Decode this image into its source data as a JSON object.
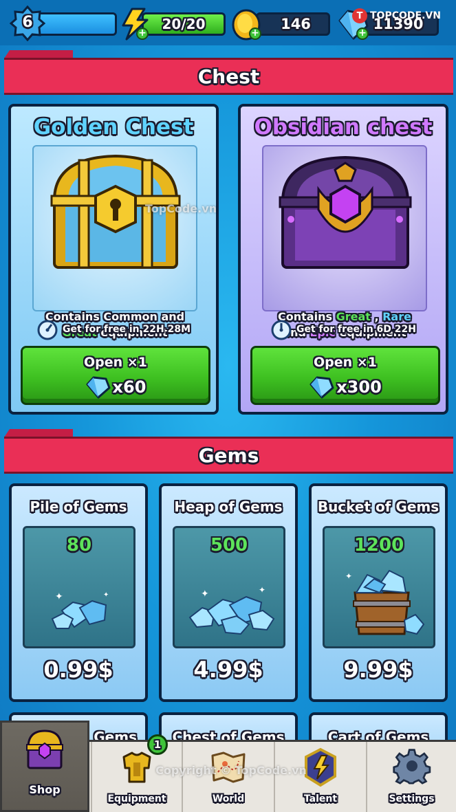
{
  "hud": {
    "level": "6",
    "level_progress": 1.0,
    "energy_text": "20/20",
    "energy_fraction": 1.0,
    "coins": "146",
    "gems": "11390",
    "watermark_logo": "TOPCODE.VN",
    "watermark_badge": "T"
  },
  "chest_section": {
    "title": "Chest",
    "cards": [
      {
        "name": "Golden Chest",
        "desc_pre": "Contains ",
        "desc_mid1": "Common",
        "desc_join": " and ",
        "desc_mid2": "Great",
        "desc_post": " equipment",
        "timer": "Get for free in 22H 28M",
        "open_label": "Open ×1",
        "price": "x60"
      },
      {
        "name": "Obsidian chest",
        "desc_pre": "Contains ",
        "desc_mid1": "Great",
        "desc_sep": " , ",
        "desc_mid2": "Rare",
        "desc_join": "and ",
        "desc_mid3": "Epic",
        "desc_post": " equipment",
        "timer": "Get for free in 6D 22H",
        "open_label": "Open ×1",
        "price": "x300"
      }
    ]
  },
  "gems_section": {
    "title": "Gems",
    "cards": [
      {
        "title": "Pile of Gems",
        "amount": "80",
        "price": "0.99$"
      },
      {
        "title": "Heap of Gems",
        "amount": "500",
        "price": "4.99$"
      },
      {
        "title": "Bucket of Gems",
        "amount": "1200",
        "price": "9.99$"
      }
    ],
    "lower_cards": [
      {
        "title": "Gems"
      },
      {
        "title": "Chest of Gems"
      },
      {
        "title": "Cart of Gems"
      }
    ]
  },
  "nav": {
    "items": [
      {
        "label": "Shop"
      },
      {
        "label": "Equipment",
        "badge": "1"
      },
      {
        "label": "World"
      },
      {
        "label": "Talent"
      },
      {
        "label": "Settings"
      }
    ]
  },
  "watermarks": {
    "center": "TopCode.vn",
    "copyright": "Copyright © TopCode.vn"
  },
  "colors": {
    "banner": "#ea2f56",
    "green_button": "#3ec021",
    "golden_title": "#5fd3ff",
    "obsidian_title": "#d079ff",
    "gem_amount": "#5de35a"
  }
}
